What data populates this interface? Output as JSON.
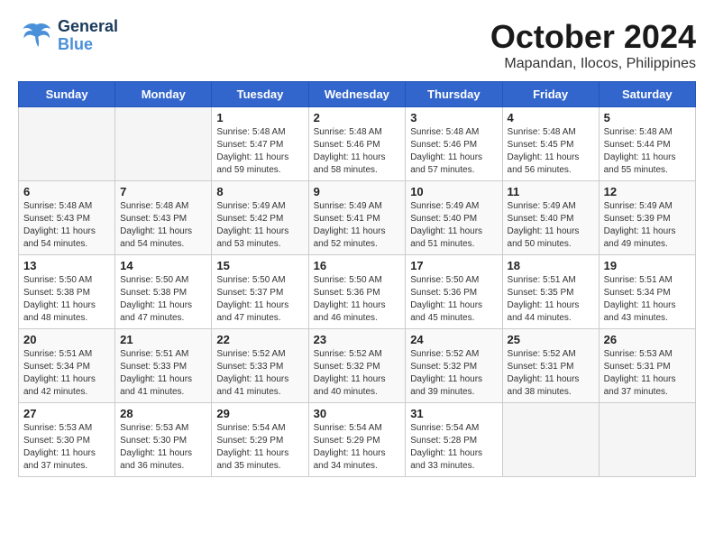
{
  "header": {
    "logo_general": "General",
    "logo_blue": "Blue",
    "month": "October 2024",
    "location": "Mapandan, Ilocos, Philippines"
  },
  "weekdays": [
    "Sunday",
    "Monday",
    "Tuesday",
    "Wednesday",
    "Thursday",
    "Friday",
    "Saturday"
  ],
  "weeks": [
    [
      {
        "day": "",
        "sunrise": "",
        "sunset": "",
        "daylight": ""
      },
      {
        "day": "",
        "sunrise": "",
        "sunset": "",
        "daylight": ""
      },
      {
        "day": "1",
        "sunrise": "Sunrise: 5:48 AM",
        "sunset": "Sunset: 5:47 PM",
        "daylight": "Daylight: 11 hours and 59 minutes."
      },
      {
        "day": "2",
        "sunrise": "Sunrise: 5:48 AM",
        "sunset": "Sunset: 5:46 PM",
        "daylight": "Daylight: 11 hours and 58 minutes."
      },
      {
        "day": "3",
        "sunrise": "Sunrise: 5:48 AM",
        "sunset": "Sunset: 5:46 PM",
        "daylight": "Daylight: 11 hours and 57 minutes."
      },
      {
        "day": "4",
        "sunrise": "Sunrise: 5:48 AM",
        "sunset": "Sunset: 5:45 PM",
        "daylight": "Daylight: 11 hours and 56 minutes."
      },
      {
        "day": "5",
        "sunrise": "Sunrise: 5:48 AM",
        "sunset": "Sunset: 5:44 PM",
        "daylight": "Daylight: 11 hours and 55 minutes."
      }
    ],
    [
      {
        "day": "6",
        "sunrise": "Sunrise: 5:48 AM",
        "sunset": "Sunset: 5:43 PM",
        "daylight": "Daylight: 11 hours and 54 minutes."
      },
      {
        "day": "7",
        "sunrise": "Sunrise: 5:48 AM",
        "sunset": "Sunset: 5:43 PM",
        "daylight": "Daylight: 11 hours and 54 minutes."
      },
      {
        "day": "8",
        "sunrise": "Sunrise: 5:49 AM",
        "sunset": "Sunset: 5:42 PM",
        "daylight": "Daylight: 11 hours and 53 minutes."
      },
      {
        "day": "9",
        "sunrise": "Sunrise: 5:49 AM",
        "sunset": "Sunset: 5:41 PM",
        "daylight": "Daylight: 11 hours and 52 minutes."
      },
      {
        "day": "10",
        "sunrise": "Sunrise: 5:49 AM",
        "sunset": "Sunset: 5:40 PM",
        "daylight": "Daylight: 11 hours and 51 minutes."
      },
      {
        "day": "11",
        "sunrise": "Sunrise: 5:49 AM",
        "sunset": "Sunset: 5:40 PM",
        "daylight": "Daylight: 11 hours and 50 minutes."
      },
      {
        "day": "12",
        "sunrise": "Sunrise: 5:49 AM",
        "sunset": "Sunset: 5:39 PM",
        "daylight": "Daylight: 11 hours and 49 minutes."
      }
    ],
    [
      {
        "day": "13",
        "sunrise": "Sunrise: 5:50 AM",
        "sunset": "Sunset: 5:38 PM",
        "daylight": "Daylight: 11 hours and 48 minutes."
      },
      {
        "day": "14",
        "sunrise": "Sunrise: 5:50 AM",
        "sunset": "Sunset: 5:38 PM",
        "daylight": "Daylight: 11 hours and 47 minutes."
      },
      {
        "day": "15",
        "sunrise": "Sunrise: 5:50 AM",
        "sunset": "Sunset: 5:37 PM",
        "daylight": "Daylight: 11 hours and 47 minutes."
      },
      {
        "day": "16",
        "sunrise": "Sunrise: 5:50 AM",
        "sunset": "Sunset: 5:36 PM",
        "daylight": "Daylight: 11 hours and 46 minutes."
      },
      {
        "day": "17",
        "sunrise": "Sunrise: 5:50 AM",
        "sunset": "Sunset: 5:36 PM",
        "daylight": "Daylight: 11 hours and 45 minutes."
      },
      {
        "day": "18",
        "sunrise": "Sunrise: 5:51 AM",
        "sunset": "Sunset: 5:35 PM",
        "daylight": "Daylight: 11 hours and 44 minutes."
      },
      {
        "day": "19",
        "sunrise": "Sunrise: 5:51 AM",
        "sunset": "Sunset: 5:34 PM",
        "daylight": "Daylight: 11 hours and 43 minutes."
      }
    ],
    [
      {
        "day": "20",
        "sunrise": "Sunrise: 5:51 AM",
        "sunset": "Sunset: 5:34 PM",
        "daylight": "Daylight: 11 hours and 42 minutes."
      },
      {
        "day": "21",
        "sunrise": "Sunrise: 5:51 AM",
        "sunset": "Sunset: 5:33 PM",
        "daylight": "Daylight: 11 hours and 41 minutes."
      },
      {
        "day": "22",
        "sunrise": "Sunrise: 5:52 AM",
        "sunset": "Sunset: 5:33 PM",
        "daylight": "Daylight: 11 hours and 41 minutes."
      },
      {
        "day": "23",
        "sunrise": "Sunrise: 5:52 AM",
        "sunset": "Sunset: 5:32 PM",
        "daylight": "Daylight: 11 hours and 40 minutes."
      },
      {
        "day": "24",
        "sunrise": "Sunrise: 5:52 AM",
        "sunset": "Sunset: 5:32 PM",
        "daylight": "Daylight: 11 hours and 39 minutes."
      },
      {
        "day": "25",
        "sunrise": "Sunrise: 5:52 AM",
        "sunset": "Sunset: 5:31 PM",
        "daylight": "Daylight: 11 hours and 38 minutes."
      },
      {
        "day": "26",
        "sunrise": "Sunrise: 5:53 AM",
        "sunset": "Sunset: 5:31 PM",
        "daylight": "Daylight: 11 hours and 37 minutes."
      }
    ],
    [
      {
        "day": "27",
        "sunrise": "Sunrise: 5:53 AM",
        "sunset": "Sunset: 5:30 PM",
        "daylight": "Daylight: 11 hours and 37 minutes."
      },
      {
        "day": "28",
        "sunrise": "Sunrise: 5:53 AM",
        "sunset": "Sunset: 5:30 PM",
        "daylight": "Daylight: 11 hours and 36 minutes."
      },
      {
        "day": "29",
        "sunrise": "Sunrise: 5:54 AM",
        "sunset": "Sunset: 5:29 PM",
        "daylight": "Daylight: 11 hours and 35 minutes."
      },
      {
        "day": "30",
        "sunrise": "Sunrise: 5:54 AM",
        "sunset": "Sunset: 5:29 PM",
        "daylight": "Daylight: 11 hours and 34 minutes."
      },
      {
        "day": "31",
        "sunrise": "Sunrise: 5:54 AM",
        "sunset": "Sunset: 5:28 PM",
        "daylight": "Daylight: 11 hours and 33 minutes."
      },
      {
        "day": "",
        "sunrise": "",
        "sunset": "",
        "daylight": ""
      },
      {
        "day": "",
        "sunrise": "",
        "sunset": "",
        "daylight": ""
      }
    ]
  ]
}
